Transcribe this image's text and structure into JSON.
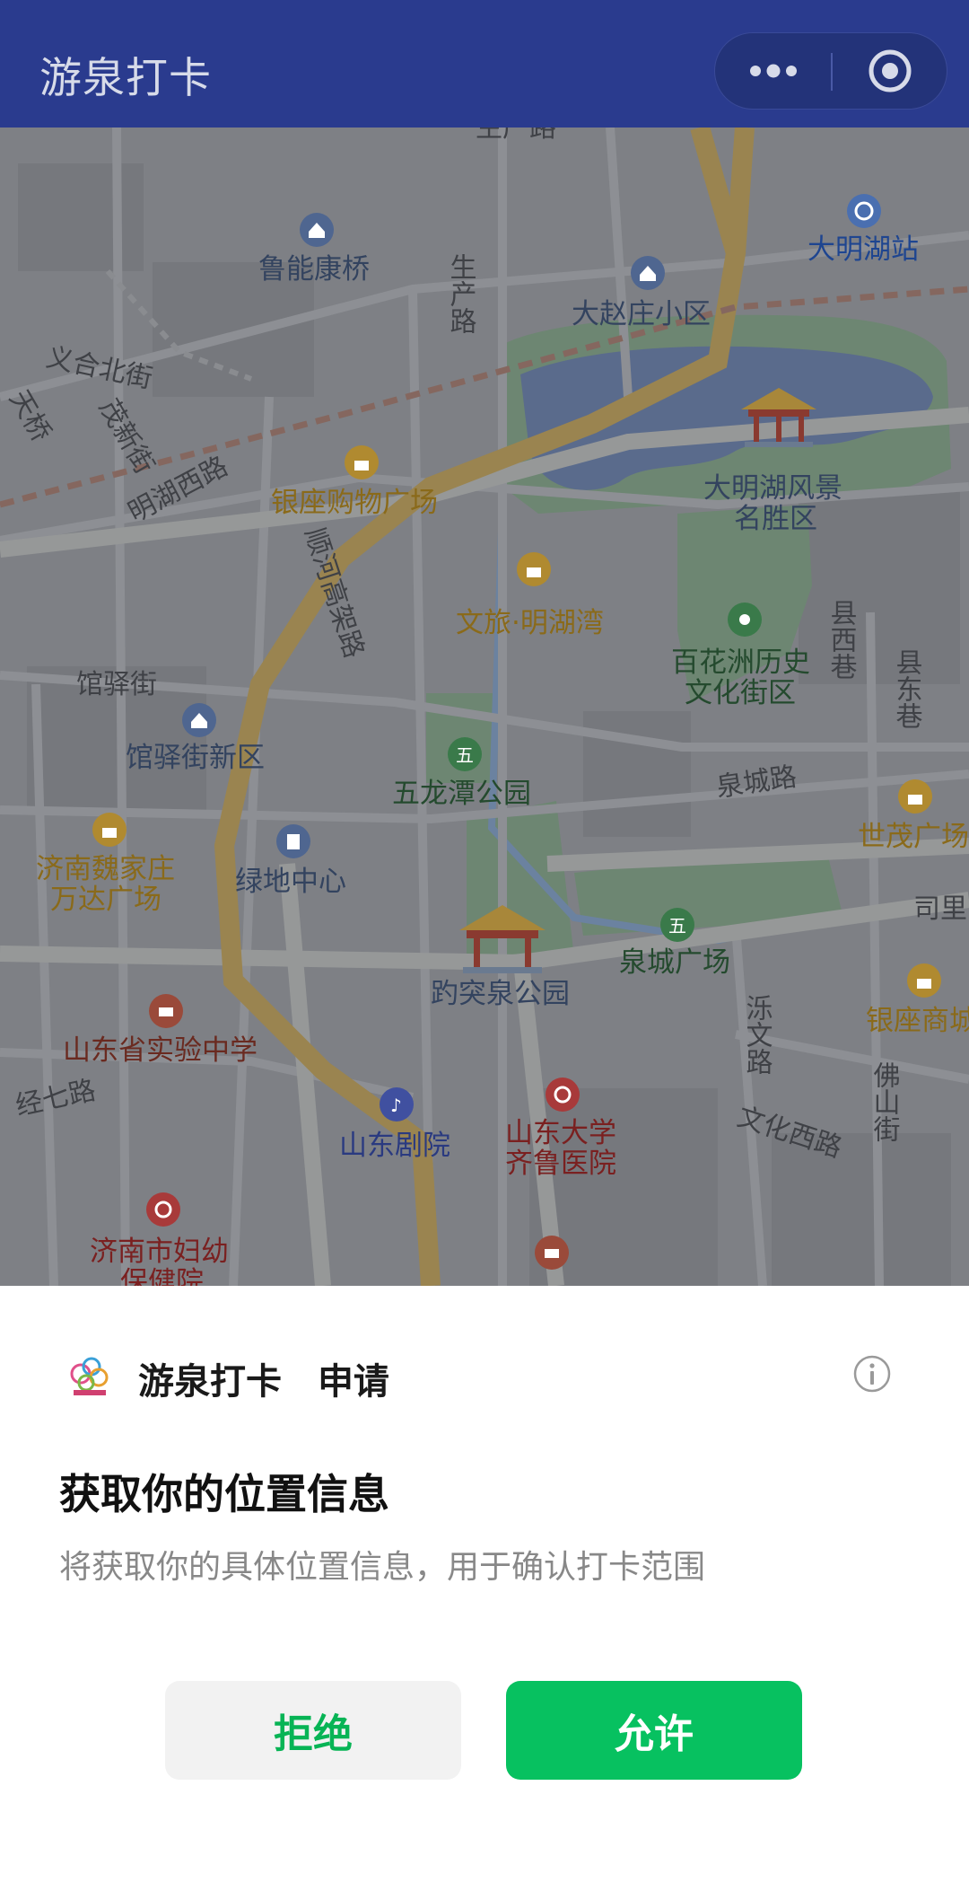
{
  "navbar": {
    "title": "游泉打卡",
    "more_icon": "more-dots-icon",
    "close_icon": "target-close-icon"
  },
  "map": {
    "roads": [
      "生产路",
      "生产路",
      "义合北街",
      "茂新街",
      "天桥",
      "明湖西路",
      "顺河高架路",
      "馆驿街",
      "泉城路",
      "县西巷",
      "县东巷",
      "经七路",
      "文化西路",
      "泺文路",
      "佛山街",
      "司里"
    ],
    "pois": [
      {
        "label": "大明湖站",
        "type": "metro-icon",
        "color": "#1e4fa8"
      },
      {
        "label": "鲁能康桥",
        "type": "residential-icon",
        "color": "#3a4f7a"
      },
      {
        "label": "大赵庄小区",
        "type": "residential-icon",
        "color": "#3a4f7a"
      },
      {
        "label": "银座购物广场",
        "type": "shopping-icon",
        "color": "#b88a1e"
      },
      {
        "label": "大明湖风景名胜区",
        "type": "scenic-pavilion-icon",
        "color": "#3a4f7a"
      },
      {
        "label": "文旅·明湖湾",
        "type": "shopping-icon",
        "color": "#b88a1e"
      },
      {
        "label": "百花洲历史文化街区",
        "type": "camera-icon",
        "color": "#2e6a3c"
      },
      {
        "label": "馆驿街新区",
        "type": "residential-icon",
        "color": "#3a4f7a"
      },
      {
        "label": "五龙潭公园",
        "type": "park-icon",
        "color": "#2e6a3c"
      },
      {
        "label": "世茂广场",
        "type": "shopping-icon",
        "color": "#b88a1e"
      },
      {
        "label": "济南魏家庄万达广场",
        "type": "shopping-icon",
        "color": "#b88a1e"
      },
      {
        "label": "绿地中心",
        "type": "office-icon",
        "color": "#3a4f7a"
      },
      {
        "label": "泉城广场",
        "type": "park-icon",
        "color": "#2e6a3c"
      },
      {
        "label": "趵突泉公园",
        "type": "scenic-pavilion-icon",
        "color": "#3a4f7a"
      },
      {
        "label": "银座商城",
        "type": "shopping-icon",
        "color": "#b88a1e"
      },
      {
        "label": "山东省实验中学",
        "type": "school-icon",
        "color": "#9a4a3a"
      },
      {
        "label": "山东剧院",
        "type": "music-icon",
        "color": "#3a4f9a"
      },
      {
        "label": "山东大学齐鲁医院",
        "type": "hospital-icon",
        "color": "#a83a3a"
      },
      {
        "label": "济南市妇幼保健院",
        "type": "hospital-icon",
        "color": "#a83a3a"
      },
      {
        "label": "山东大学",
        "type": "school-icon",
        "color": "#9a4a3a"
      }
    ]
  },
  "dialog": {
    "app_name": "游泉打卡",
    "request_word": "申请",
    "title": "获取你的位置信息",
    "description": "将获取你的具体位置信息，用于确认打卡范围",
    "deny_label": "拒绝",
    "allow_label": "允许",
    "info_icon": "info-icon",
    "accent_color": "#07c160"
  }
}
